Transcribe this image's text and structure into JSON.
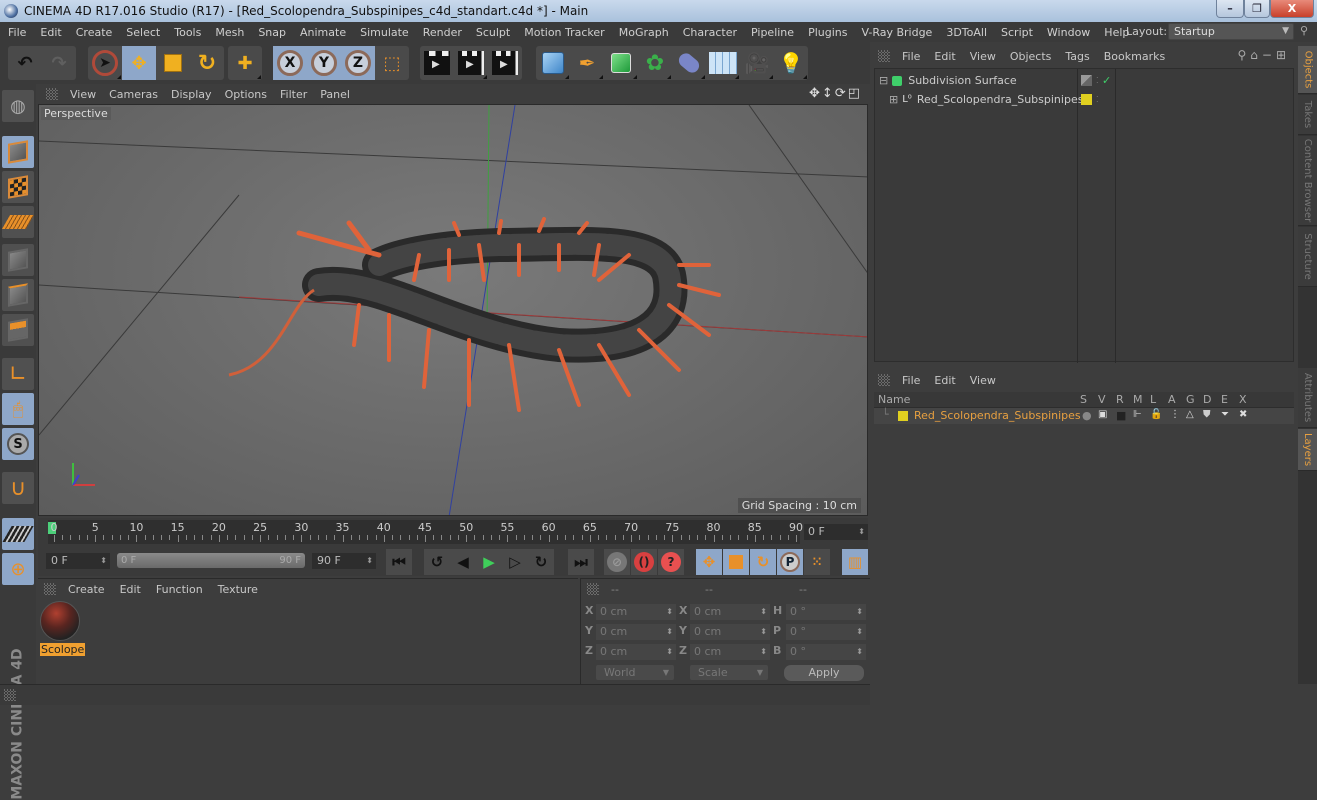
{
  "window": {
    "title": "CINEMA 4D R17.016 Studio (R17) - [Red_Scolopendra_Subspinipes_c4d_standart.c4d *] - Main",
    "controls": {
      "minimize": "–",
      "maximize": "❐",
      "close": "X"
    }
  },
  "menubar": {
    "items": [
      "File",
      "Edit",
      "Create",
      "Select",
      "Tools",
      "Mesh",
      "Snap",
      "Animate",
      "Simulate",
      "Render",
      "Sculpt",
      "Motion Tracker",
      "MoGraph",
      "Character",
      "Pipeline",
      "Plugins",
      "V-Ray Bridge",
      "3DToAll",
      "Script",
      "Window",
      "Help"
    ],
    "layout_label": "Layout:",
    "layout_value": "Startup"
  },
  "toolbar": {
    "undo": "undo-icon",
    "redo": "redo-icon",
    "tools": [
      "live-selection",
      "move",
      "scale",
      "rotate",
      "recent-transform"
    ],
    "axes": [
      "X",
      "Y",
      "Z"
    ],
    "coordinate_system": "world-coordinates-icon",
    "render": [
      "render-view",
      "render-picture-viewer",
      "edit-render-settings"
    ],
    "objects": [
      "cube",
      "pen-spline",
      "subdivision-surface",
      "cloner",
      "deformer",
      "floor-environment",
      "camera",
      "light"
    ]
  },
  "left_tools": [
    "make-editable",
    "model-mode",
    "texture-mode",
    "workplane-mode",
    "points-mode",
    "edges-mode",
    "polygons-mode",
    "axis-mode",
    "tweak-mode",
    "snapping",
    "magnet"
  ],
  "viewport": {
    "menu": [
      "View",
      "Cameras",
      "Display",
      "Options",
      "Filter",
      "Panel"
    ],
    "label": "Perspective",
    "grid_spacing": "Grid Spacing : 10 cm"
  },
  "timeline": {
    "ticks": [
      "0",
      "5",
      "10",
      "15",
      "20",
      "25",
      "30",
      "35",
      "40",
      "45",
      "50",
      "55",
      "60",
      "65",
      "70",
      "75",
      "80",
      "85",
      "90"
    ],
    "current_frame": "0 F",
    "start_field": "0 F",
    "range_start": "0 F",
    "range_end": "90 F",
    "end_field": "90 F"
  },
  "material_manager": {
    "menu": [
      "Create",
      "Edit",
      "Function",
      "Texture"
    ],
    "materials": [
      {
        "name": "Scolope"
      }
    ]
  },
  "coordinates": {
    "headers": [
      "--",
      "--",
      "--"
    ],
    "rows": [
      {
        "l1": "X",
        "v1": "0 cm",
        "l2": "X",
        "v2": "0 cm",
        "l3": "H",
        "v3": "0 °"
      },
      {
        "l1": "Y",
        "v1": "0 cm",
        "l2": "Y",
        "v2": "0 cm",
        "l3": "P",
        "v3": "0 °"
      },
      {
        "l1": "Z",
        "v1": "0 cm",
        "l2": "Z",
        "v2": "0 cm",
        "l3": "B",
        "v3": "0 °"
      }
    ],
    "mode": "World",
    "transform": "Scale",
    "apply": "Apply"
  },
  "object_manager": {
    "menu": [
      "File",
      "Edit",
      "View",
      "Objects",
      "Tags",
      "Bookmarks"
    ],
    "objects": [
      {
        "name": "Subdivision Surface",
        "checked": "✓"
      },
      {
        "name": "Red_Scolopendra_Subspinipes"
      }
    ]
  },
  "layer_manager": {
    "menu": [
      "File",
      "Edit",
      "View"
    ],
    "columns": [
      "Name",
      "S",
      "V",
      "R",
      "M",
      "L",
      "A",
      "G",
      "D",
      "E",
      "X"
    ],
    "layers": [
      {
        "name": "Red_Scolopendra_Subspinipes",
        "color": "#e0d020"
      }
    ]
  },
  "side_tabs": {
    "top": [
      "Objects",
      "Takes",
      "Content Browser",
      "Structure"
    ],
    "bottom": [
      "Attributes",
      "Layers"
    ]
  },
  "branding": "MAXON CINEMA 4D",
  "colors": {
    "accent_orange": "#e8a040",
    "active_blue": "#8ea7c9",
    "layer_yellow": "#e0d020",
    "playhead_green": "#4ccf7a"
  }
}
